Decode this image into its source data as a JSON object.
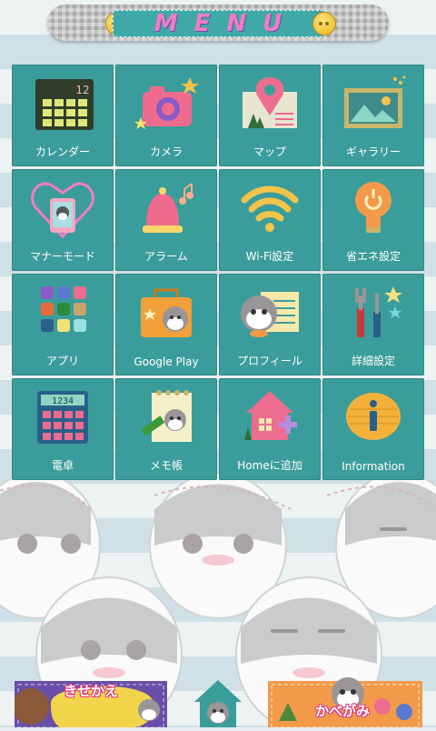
{
  "header": {
    "title": "MENU"
  },
  "tiles": [
    {
      "label": "カレンダー",
      "icon": "calendar-icon",
      "badge": "12"
    },
    {
      "label": "カメラ",
      "icon": "camera-icon"
    },
    {
      "label": "マップ",
      "icon": "map-pin-icon"
    },
    {
      "label": "ギャラリー",
      "icon": "gallery-icon"
    },
    {
      "label": "マナーモード",
      "icon": "manner-mode-icon"
    },
    {
      "label": "アラーム",
      "icon": "alarm-bell-icon"
    },
    {
      "label": "Wi-Fi設定",
      "icon": "wifi-icon"
    },
    {
      "label": "省エネ設定",
      "icon": "power-saving-bulb-icon"
    },
    {
      "label": "アプリ",
      "icon": "apps-grid-icon"
    },
    {
      "label": "Google Play",
      "icon": "google-play-bag-icon"
    },
    {
      "label": "プロフィール",
      "icon": "profile-icon"
    },
    {
      "label": "詳細設定",
      "icon": "tools-icon"
    },
    {
      "label": "電卓",
      "icon": "calculator-icon",
      "display": "1234"
    },
    {
      "label": "メモ帳",
      "icon": "memo-pad-icon"
    },
    {
      "label": "Homeに追加",
      "icon": "add-home-icon"
    },
    {
      "label": "Information",
      "icon": "information-icon"
    }
  ],
  "dock": {
    "left_label": "きせかえ",
    "right_label": "かべがみ"
  },
  "colors": {
    "tile": "#3b9d9b",
    "title_pink": "#f27dc1"
  }
}
